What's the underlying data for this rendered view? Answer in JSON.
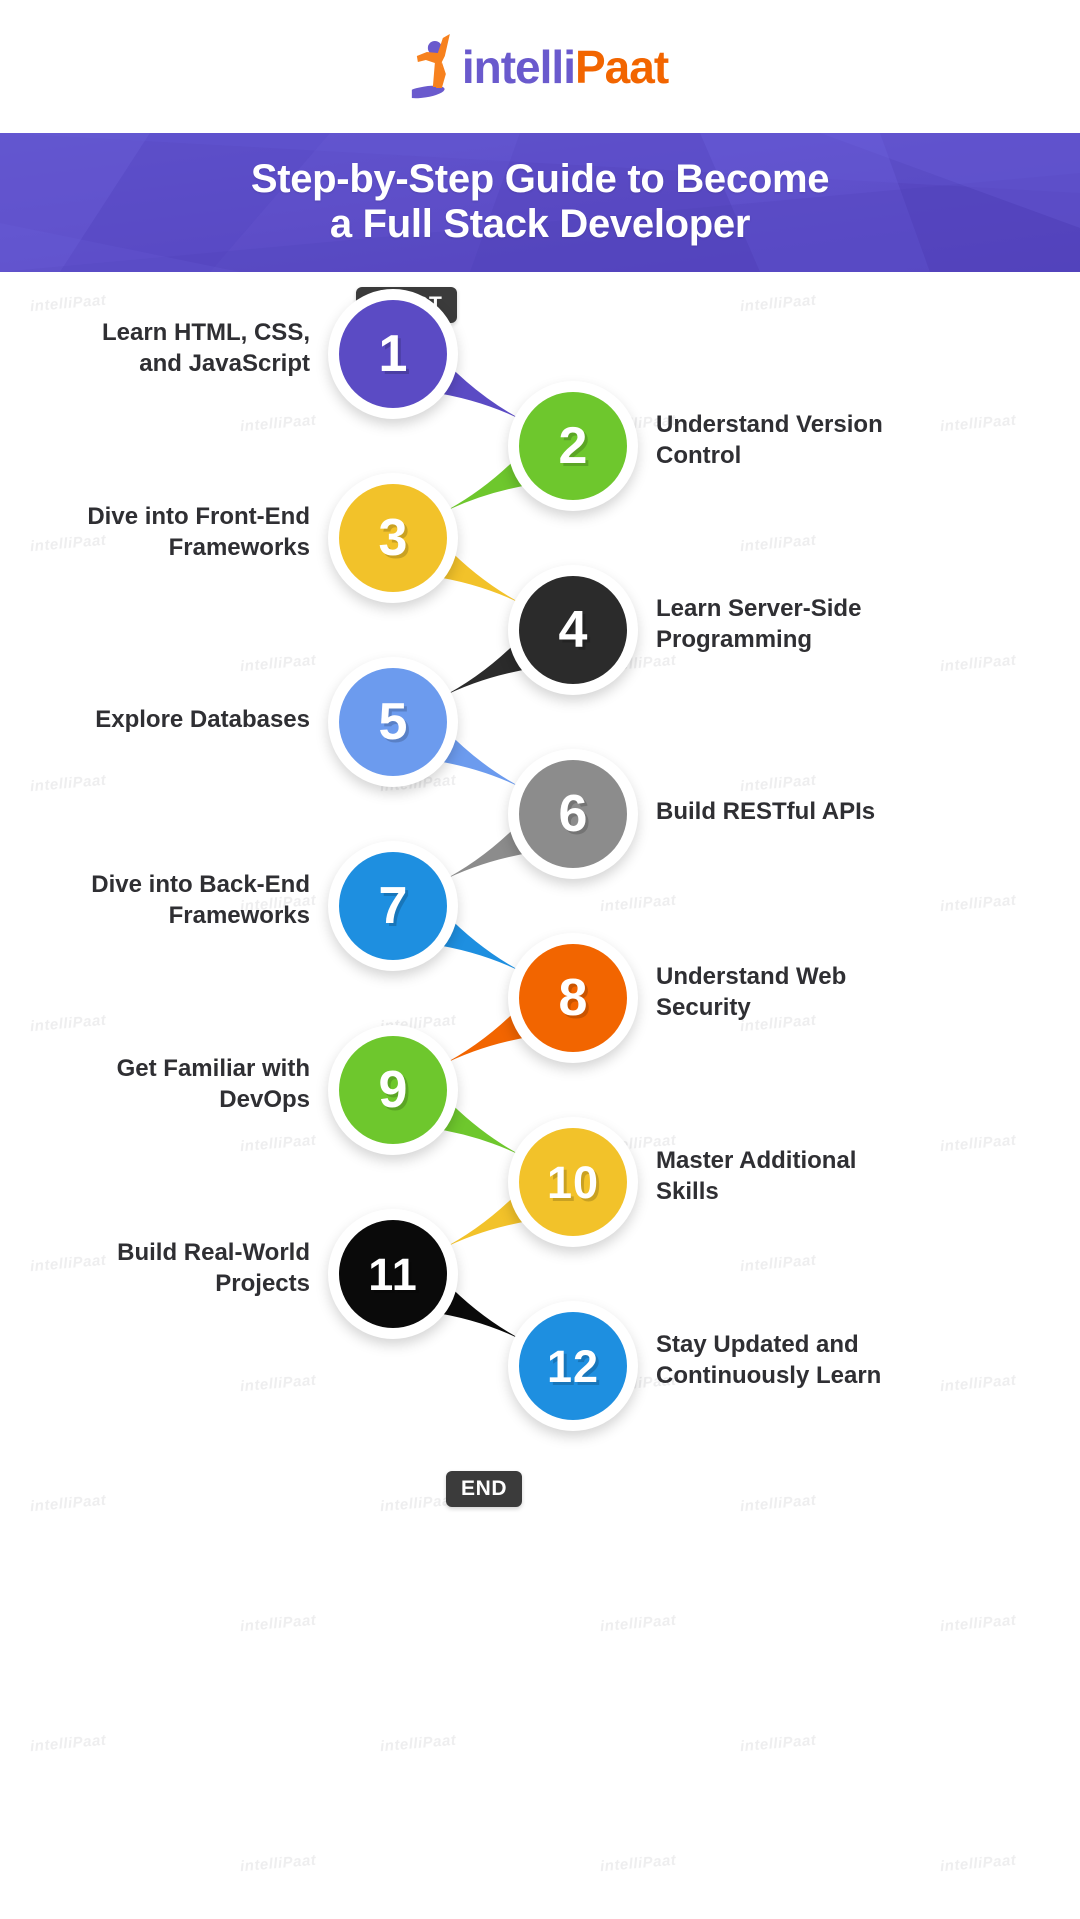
{
  "logo": {
    "part1": "intelli",
    "part2": "Paat",
    "icon": "running-person-icon",
    "colors": {
      "part1": "#6A5ACD",
      "part2": "#F26500"
    }
  },
  "banner": {
    "line1": "Step-by-Step Guide to Become",
    "line2": "a Full Stack Developer",
    "bg": "#5B4BC4",
    "text_color": "#FFFFFF"
  },
  "flow": {
    "start_label": "START",
    "end_label": "END",
    "badge_bg": "#3B3B3B",
    "steps": [
      {
        "number": "1",
        "label": "Learn HTML, CSS,\nand JavaScript",
        "label_line1": "Learn HTML, CSS,",
        "label_line2": "and JavaScript",
        "side": "right",
        "color": "#5B4BC4"
      },
      {
        "number": "2",
        "label": "Understand Version\nControl",
        "label_line1": "Understand Version",
        "label_line2": "Control",
        "side": "left",
        "color": "#6EC72D"
      },
      {
        "number": "3",
        "label": "Dive into Front-End\nFrameworks",
        "label_line1": "Dive into Front-End",
        "label_line2": "Frameworks",
        "side": "right",
        "color": "#F2C22A"
      },
      {
        "number": "4",
        "label": "Learn Server-Side\nProgramming",
        "label_line1": "Learn Server-Side",
        "label_line2": "Programming",
        "side": "left",
        "color": "#2B2B2B"
      },
      {
        "number": "5",
        "label": "Explore Databases",
        "label_line1": "Explore Databases",
        "label_line2": "",
        "side": "right",
        "color": "#6C9BEE"
      },
      {
        "number": "6",
        "label": "Build RESTful APIs",
        "label_line1": "Build RESTful APIs",
        "label_line2": "",
        "side": "left",
        "color": "#8C8C8C"
      },
      {
        "number": "7",
        "label": "Dive into Back-End\nFrameworks",
        "label_line1": "Dive into Back-End",
        "label_line2": "Frameworks",
        "side": "right",
        "color": "#1E8FE0"
      },
      {
        "number": "8",
        "label": "Understand Web\nSecurity",
        "label_line1": "Understand Web",
        "label_line2": "Security",
        "side": "left",
        "color": "#F26500"
      },
      {
        "number": "9",
        "label": "Get Familiar with\nDevOps",
        "label_line1": "Get Familiar with",
        "label_line2": "DevOps",
        "side": "right",
        "color": "#6EC72D"
      },
      {
        "number": "10",
        "label": "Master Additional\nSkills",
        "label_line1": "Master Additional",
        "label_line2": "Skills",
        "side": "left",
        "color": "#F2C22A"
      },
      {
        "number": "11",
        "label": "Build Real-World\nProjects",
        "label_line1": "Build Real-World",
        "label_line2": "Projects",
        "side": "right",
        "color": "#0A0A0A"
      },
      {
        "number": "12",
        "label": "Stay Updated and\nContinuously Learn",
        "label_line1": "Stay Updated and",
        "label_line2": "Continuously Learn",
        "side": "left",
        "color": "#1E8FE0"
      }
    ]
  },
  "watermark": {
    "text": "intelliPaat"
  }
}
